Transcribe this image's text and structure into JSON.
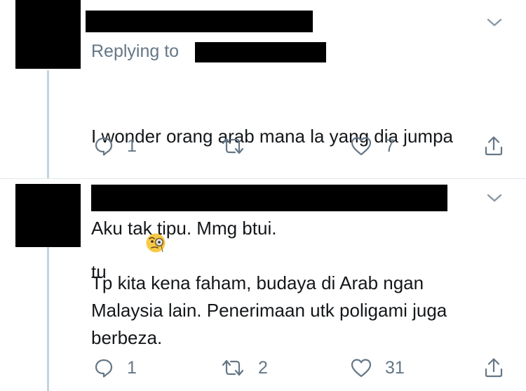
{
  "tweet1": {
    "replying_label": "Replying to",
    "text_line1": "I wonder orang arab mana la yang dia jumpa",
    "text_line2": "tu",
    "emoji_name": "face-with-monocle-icon",
    "reply_count": "1",
    "retweet_count": "",
    "like_count": "7"
  },
  "tweet2": {
    "text": "Aku tak tipu. Mmg btui.\n\nTp kita kena faham, budaya di Arab ngan\nMalaysia lain. Penerimaan utk poligami juga\nberbeza.",
    "reply_count": "1",
    "retweet_count": "2",
    "like_count": "31"
  },
  "colors": {
    "text": "#14171a",
    "secondary": "#657786",
    "thread_line": "#c6d3dc",
    "divider": "#e1e8ed"
  }
}
